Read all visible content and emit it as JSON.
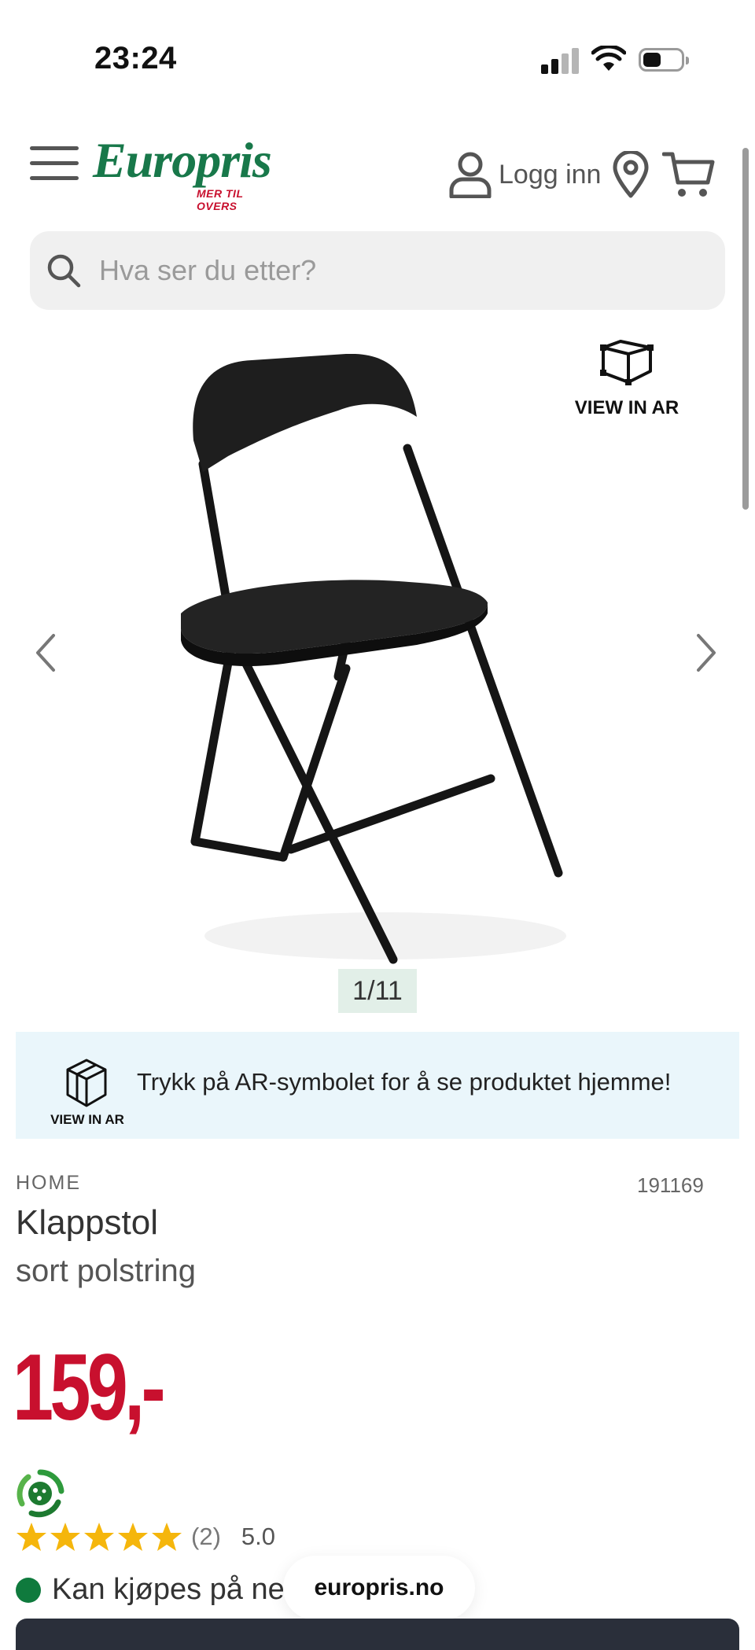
{
  "status_bar": {
    "time": "23:24"
  },
  "header": {
    "logo_text": "Europris",
    "logo_tagline": "MER TIL OVERS",
    "login_label": "Logg inn",
    "icons": [
      "menu-icon",
      "user-icon",
      "location-pin-icon",
      "cart-icon"
    ]
  },
  "search": {
    "placeholder": "Hva ser du etter?"
  },
  "gallery": {
    "ar_label": "VIEW IN AR",
    "counter": "1/11",
    "current_image": 1,
    "total_images": 11
  },
  "ar_banner": {
    "label": "VIEW IN AR",
    "text": "Trykk på AR-symbolet for å se produktet hjemme!"
  },
  "product": {
    "category": "HOME",
    "sku": "191169",
    "title": "Klappstol",
    "subtitle": "sort polstring",
    "price": "159,-",
    "rating_stars": 5,
    "rating_count": "(2)",
    "rating_score": "5.0",
    "availability": "Kan kjøpes på net"
  },
  "browser": {
    "url": "europris.no"
  },
  "colors": {
    "brand_green": "#18784a",
    "price_red": "#c8102e",
    "star_gold": "#f5b60c",
    "available_green": "#0f7a3d"
  }
}
